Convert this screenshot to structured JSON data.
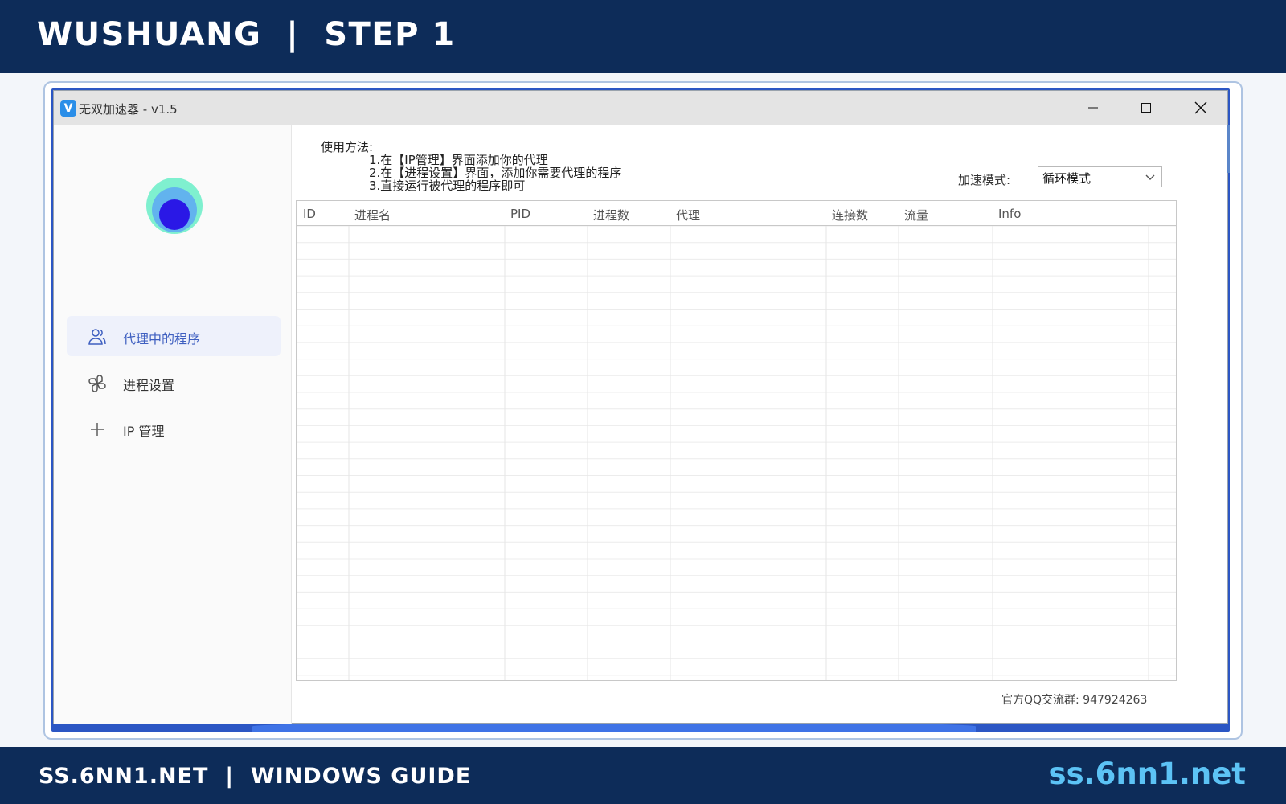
{
  "banner": {
    "title": "WUSHUANG  |  STEP 1",
    "footer_left": "SS.6NN1.NET  |  WINDOWS GUIDE",
    "footer_right": "ss.6nn1.net"
  },
  "window": {
    "app_icon_letter": "V",
    "title": "无双加速器 - v1.5",
    "controls": [
      "minimize-icon",
      "maximize-icon",
      "close-icon"
    ]
  },
  "sidebar": {
    "logo_icon": "concentric-circles-logo",
    "items": [
      {
        "label": "代理中的程序",
        "icon": "users-icon",
        "active": true
      },
      {
        "label": "进程设置",
        "icon": "pinwheel-icon",
        "active": false
      },
      {
        "label": "IP 管理",
        "icon": "plus-icon",
        "active": false
      }
    ]
  },
  "main": {
    "usage_title": "使用方法:",
    "usage_steps": [
      "1.在【IP管理】界面添加你的代理",
      "2.在【进程设置】界面，添加你需要代理的程序",
      "3.直接运行被代理的程序即可"
    ],
    "mode_label": "加速模式:",
    "mode_value": "循环模式",
    "table": {
      "columns": [
        "ID",
        "进程名",
        "PID",
        "进程数",
        "代理",
        "连接数",
        "流量",
        "Info"
      ],
      "rows": []
    },
    "footer_text": "官方QQ交流群: 947924263"
  },
  "colors": {
    "banner_bg": "#0d2c59",
    "accent_link": "#5cc3f5",
    "active_nav": "#3e5fc0"
  }
}
